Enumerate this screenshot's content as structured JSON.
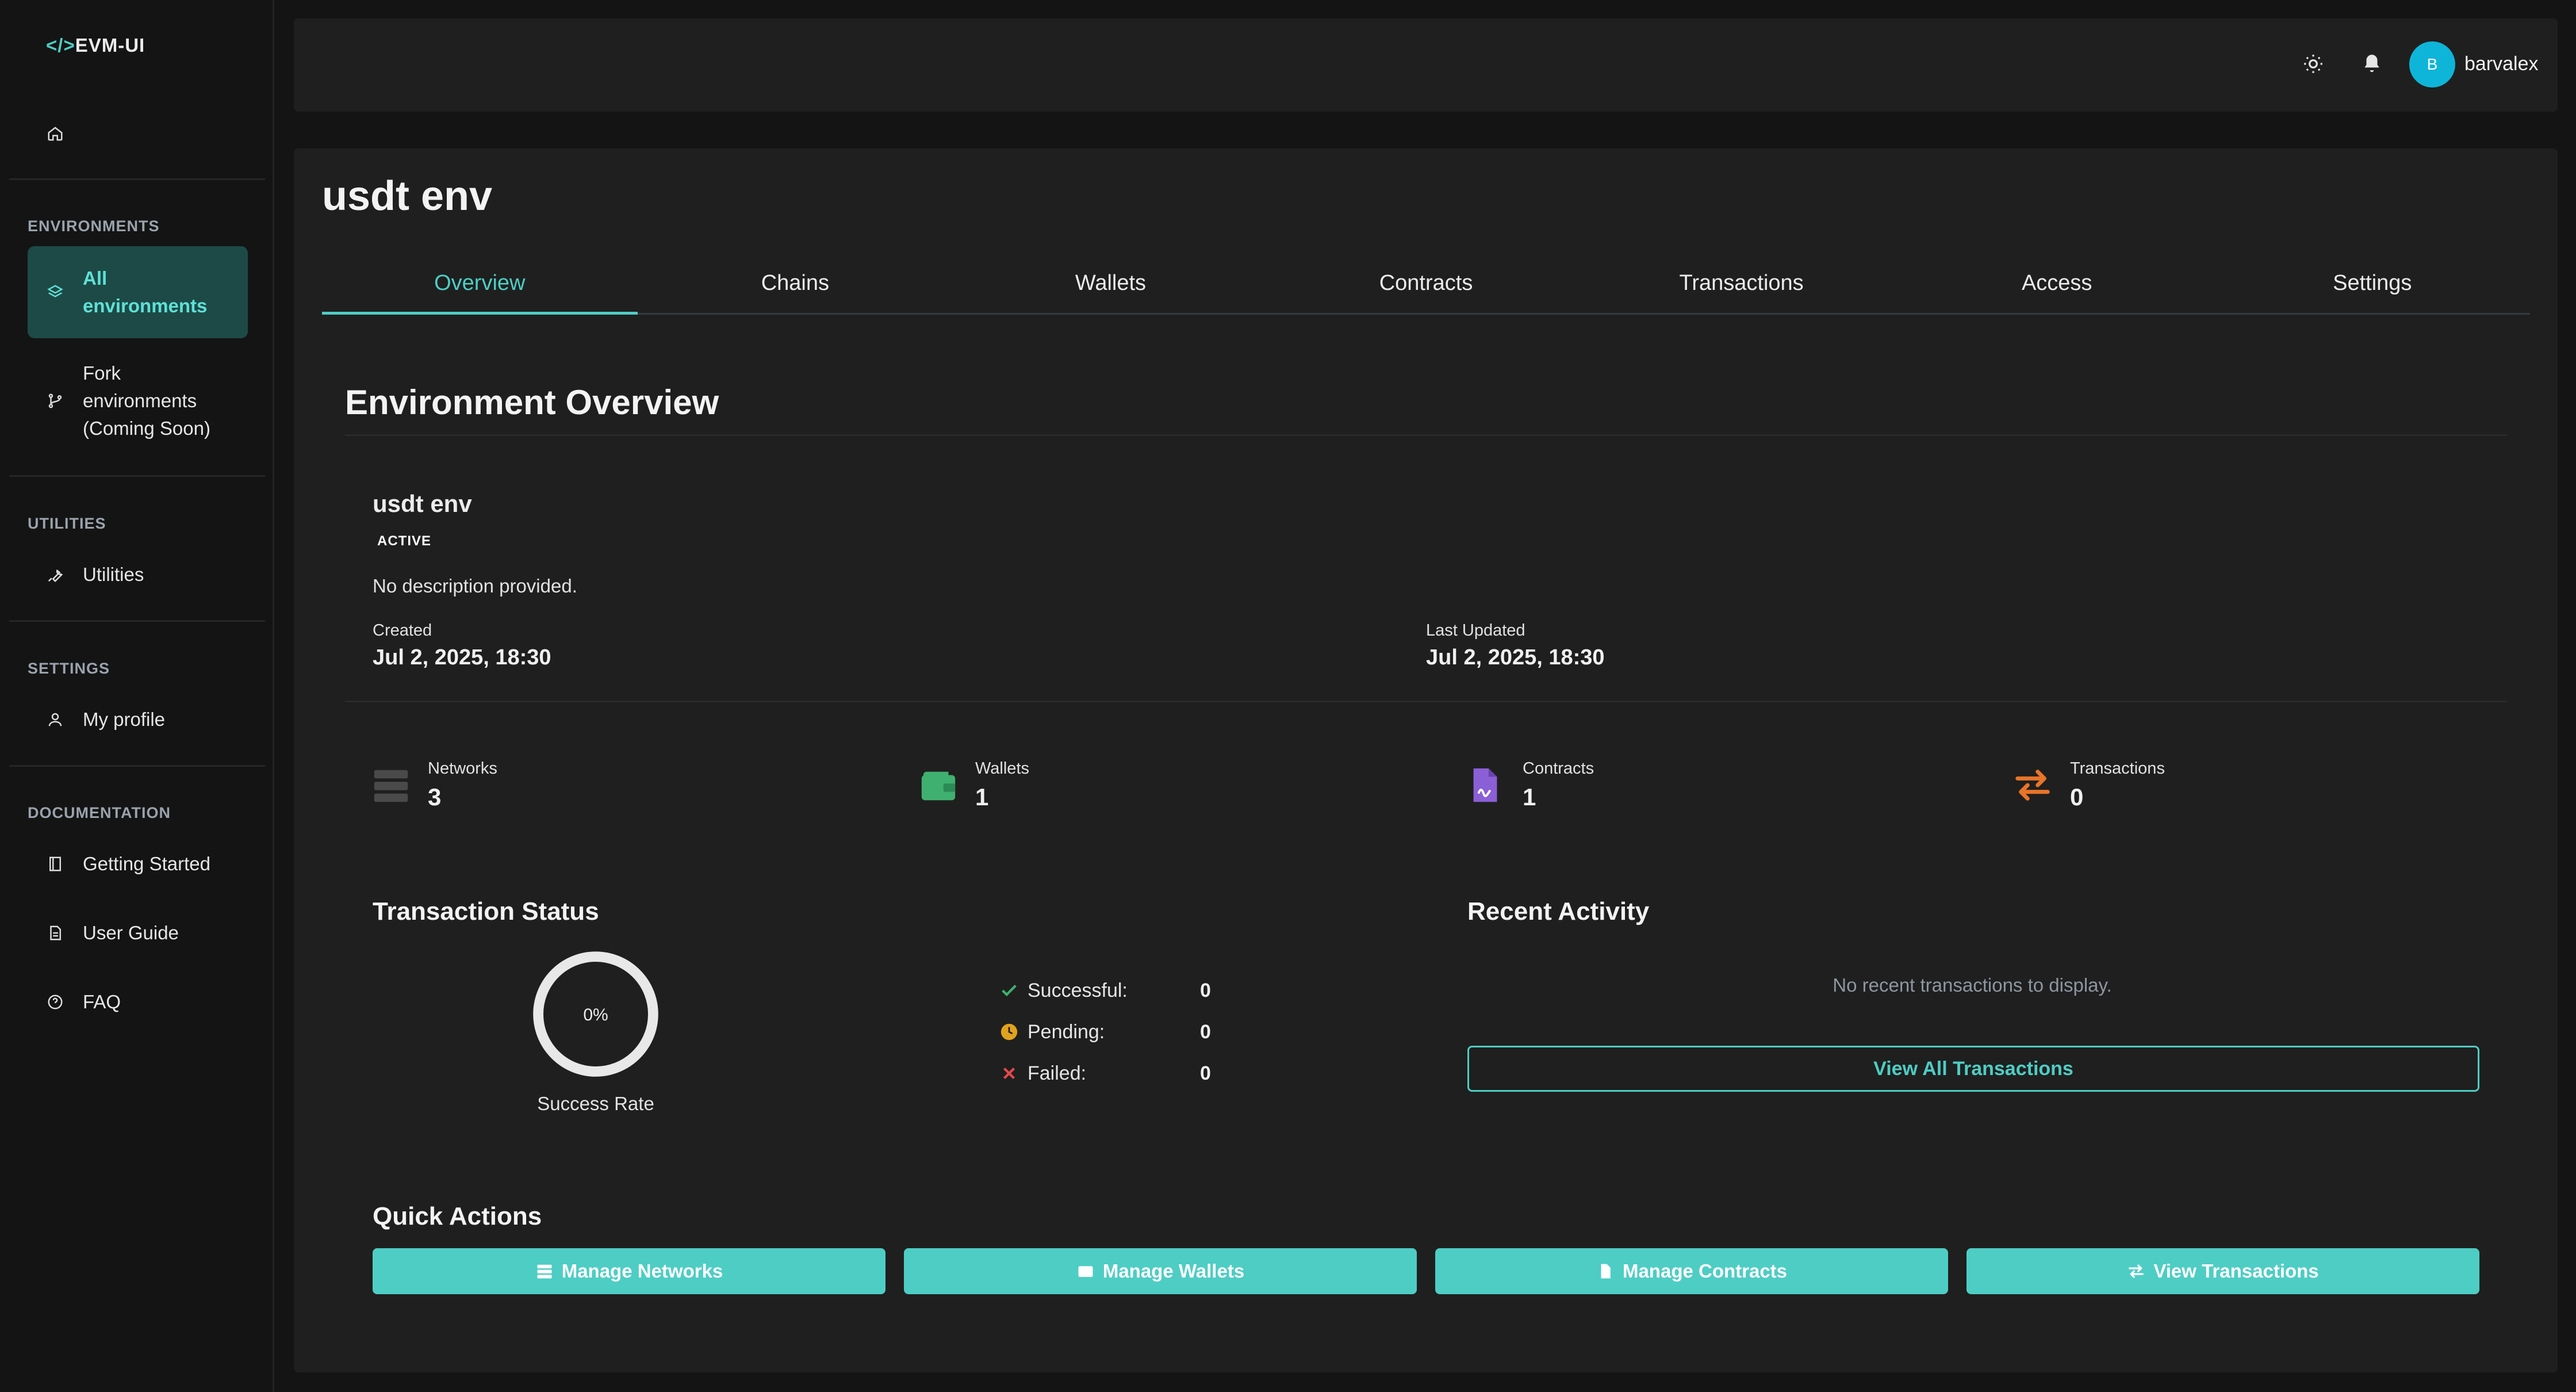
{
  "app": {
    "logo_code": "</>",
    "logo_name": "EVM-UI"
  },
  "sidebar": {
    "dashboard": "Dashboard",
    "sections": {
      "environments": "ENVIRONMENTS",
      "utilities": "UTILITIES",
      "settings": "SETTINGS",
      "documentation": "DOCUMENTATION"
    },
    "items": {
      "all_env_line1": "All",
      "all_env_line2": "environments",
      "fork_line1": "Fork",
      "fork_line2": "environments",
      "fork_line3": "(Coming Soon)",
      "utilities": "Utilities",
      "profile": "My profile",
      "getting_started": "Getting Started",
      "user_guide": "User Guide",
      "faq": "FAQ"
    }
  },
  "topbar": {
    "icons": [
      "sun-icon",
      "bell-icon"
    ],
    "avatar_initial": "B",
    "username": "barvalex"
  },
  "page": {
    "title": "usdt env",
    "tabs": [
      "Overview",
      "Chains",
      "Wallets",
      "Contracts",
      "Transactions",
      "Access",
      "Settings"
    ],
    "active_tab": "Overview"
  },
  "overview": {
    "heading": "Environment Overview",
    "env_name": "usdt env",
    "status_badge": "ACTIVE",
    "description": "No description provided.",
    "created_label": "Created",
    "created_value": "Jul 2, 2025, 18:30",
    "updated_label": "Last Updated",
    "updated_value": "Jul 2, 2025, 18:30"
  },
  "stats": [
    {
      "label": "Networks",
      "value": "3",
      "icon": "server-icon",
      "color": "#4a4a4a"
    },
    {
      "label": "Wallets",
      "value": "1",
      "icon": "wallet-icon",
      "color": "#3fb06f"
    },
    {
      "label": "Contracts",
      "value": "1",
      "icon": "contract-file-icon",
      "color": "#8b5fd6"
    },
    {
      "label": "Transactions",
      "value": "0",
      "icon": "exchange-arrows-icon",
      "color": "#e8742a"
    }
  ],
  "tx_status": {
    "heading": "Transaction Status",
    "rate": "0%",
    "rate_label": "Success Rate",
    "successful_label": "Successful:",
    "successful_value": "0",
    "pending_label": "Pending:",
    "pending_value": "0",
    "failed_label": "Failed:",
    "failed_value": "0"
  },
  "recent": {
    "heading": "Recent Activity",
    "empty": "No recent transactions to display.",
    "view_all": "View All Transactions"
  },
  "quick_actions": {
    "heading": "Quick Actions",
    "networks": "Manage Networks",
    "wallets": "Manage Wallets",
    "contracts": "Manage Contracts",
    "transactions": "View Transactions"
  },
  "colors": {
    "accent": "#4ecdc4",
    "success": "#3fb06f",
    "pending": "#e0a21f",
    "failed": "#e5484d"
  }
}
